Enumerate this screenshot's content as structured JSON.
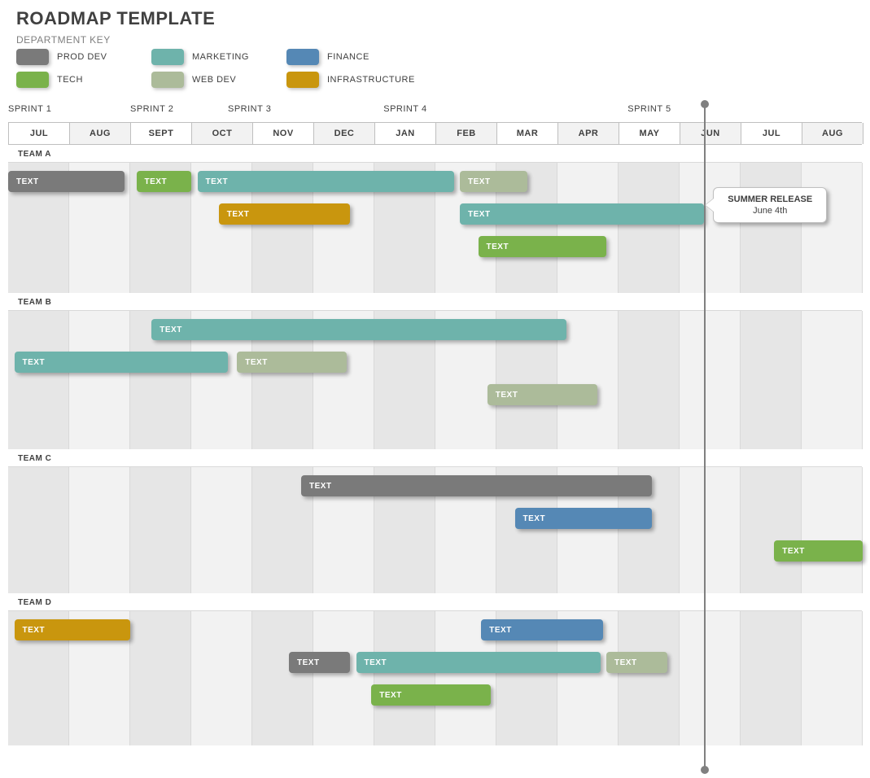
{
  "title": "ROADMAP TEMPLATE",
  "department_key_label": "DEPARTMENT KEY",
  "legend": [
    {
      "name": "PROD DEV",
      "cls": "c-proddev"
    },
    {
      "name": "MARKETING",
      "cls": "c-marketing"
    },
    {
      "name": "FINANCE",
      "cls": "c-finance"
    },
    {
      "name": "TECH",
      "cls": "c-tech"
    },
    {
      "name": "WEB DEV",
      "cls": "c-webdev"
    },
    {
      "name": "INFRASTRUCTURE",
      "cls": "c-infra"
    }
  ],
  "sprints": [
    {
      "label": "SPRINT 1",
      "col": 0
    },
    {
      "label": "SPRINT 2",
      "col": 2
    },
    {
      "label": "SPRINT 3",
      "col": 3.6
    },
    {
      "label": "SPRINT 4",
      "col": 6.15
    },
    {
      "label": "SPRINT 5",
      "col": 10.15
    }
  ],
  "months": [
    "JUL",
    "AUG",
    "SEPT",
    "OCT",
    "NOV",
    "DEC",
    "JAN",
    "FEB",
    "MAR",
    "APR",
    "MAY",
    "JUN",
    "JUL",
    "AUG"
  ],
  "milestone": {
    "title": "SUMMER RELEASE",
    "sub": "June 4th"
  },
  "teams": [
    {
      "name": "TEAM A",
      "height": 160,
      "bars": [
        {
          "label": "TEXT",
          "cls": "c-proddev",
          "start": 0,
          "span": 1.9,
          "row": 0
        },
        {
          "label": "TEXT",
          "cls": "c-tech",
          "start": 2.1,
          "span": 0.9,
          "row": 0
        },
        {
          "label": "TEXT",
          "cls": "c-marketing",
          "start": 3.1,
          "span": 4.2,
          "row": 0
        },
        {
          "label": "TEXT",
          "cls": "c-webdev",
          "start": 7.4,
          "span": 1.1,
          "row": 0
        },
        {
          "label": "TEXT",
          "cls": "c-infra",
          "start": 3.45,
          "span": 2.15,
          "row": 1
        },
        {
          "label": "TEXT",
          "cls": "c-marketing",
          "start": 7.4,
          "span": 4.0,
          "row": 1
        },
        {
          "label": "TEXT",
          "cls": "c-tech",
          "start": 7.7,
          "span": 2.1,
          "row": 2
        }
      ]
    },
    {
      "name": "TEAM B",
      "height": 170,
      "bars": [
        {
          "label": "TEXT",
          "cls": "c-marketing",
          "start": 2.35,
          "span": 6.8,
          "row": 0
        },
        {
          "label": "TEXT",
          "cls": "c-marketing",
          "start": 0.1,
          "span": 3.5,
          "row": 1
        },
        {
          "label": "TEXT",
          "cls": "c-webdev",
          "start": 3.75,
          "span": 1.8,
          "row": 1
        },
        {
          "label": "TEXT",
          "cls": "c-webdev",
          "start": 7.85,
          "span": 1.8,
          "row": 2
        }
      ]
    },
    {
      "name": "TEAM C",
      "height": 155,
      "bars": [
        {
          "label": "TEXT",
          "cls": "c-proddev",
          "start": 4.8,
          "span": 5.75,
          "row": 0
        },
        {
          "label": "TEXT",
          "cls": "c-finance",
          "start": 8.3,
          "span": 2.25,
          "row": 1
        },
        {
          "label": "TEXT",
          "cls": "c-tech",
          "start": 12.55,
          "span": 1.45,
          "row": 2
        }
      ]
    },
    {
      "name": "TEAM D",
      "height": 165,
      "bars": [
        {
          "label": "TEXT",
          "cls": "c-infra",
          "start": 0.1,
          "span": 1.9,
          "row": 0
        },
        {
          "label": "TEXT",
          "cls": "c-finance",
          "start": 7.75,
          "span": 2.0,
          "row": 0
        },
        {
          "label": "TEXT",
          "cls": "c-proddev",
          "start": 4.6,
          "span": 1.0,
          "row": 1
        },
        {
          "label": "TEXT",
          "cls": "c-marketing",
          "start": 5.7,
          "span": 4.0,
          "row": 1
        },
        {
          "label": "TEXT",
          "cls": "c-webdev",
          "start": 9.8,
          "span": 1.0,
          "row": 1
        },
        {
          "label": "TEXT",
          "cls": "c-tech",
          "start": 5.95,
          "span": 1.95,
          "row": 2
        }
      ]
    }
  ],
  "chart_data": {
    "type": "gantt",
    "title": "ROADMAP TEMPLATE",
    "x_axis_months": [
      "JUL",
      "AUG",
      "SEPT",
      "OCT",
      "NOV",
      "DEC",
      "JAN",
      "FEB",
      "MAR",
      "APR",
      "MAY",
      "JUN",
      "JUL",
      "AUG"
    ],
    "sprint_markers": {
      "SPRINT 1": "JUL",
      "SPRINT 2": "SEPT",
      "SPRINT 3": "mid-OCT",
      "SPRINT 4": "JAN",
      "SPRINT 5": "MAY"
    },
    "milestone": {
      "name": "SUMMER RELEASE",
      "date": "June 4th"
    },
    "departments": [
      "PROD DEV",
      "MARKETING",
      "FINANCE",
      "TECH",
      "WEB DEV",
      "INFRASTRUCTURE"
    ],
    "teams": {
      "TEAM A": [
        {
          "dept": "PROD DEV",
          "label": "TEXT",
          "start_month": "JUL",
          "end_month": "AUG"
        },
        {
          "dept": "TECH",
          "label": "TEXT",
          "start_month": "SEPT",
          "end_month": "SEPT"
        },
        {
          "dept": "MARKETING",
          "label": "TEXT",
          "start_month": "OCT",
          "end_month": "JAN"
        },
        {
          "dept": "WEB DEV",
          "label": "TEXT",
          "start_month": "FEB",
          "end_month": "FEB"
        },
        {
          "dept": "INFRASTRUCTURE",
          "label": "TEXT",
          "start_month": "mid-OCT",
          "end_month": "mid-DEC"
        },
        {
          "dept": "MARKETING",
          "label": "TEXT",
          "start_month": "FEB",
          "end_month": "MAY"
        },
        {
          "dept": "TECH",
          "label": "TEXT",
          "start_month": "mid-FEB",
          "end_month": "APR"
        }
      ],
      "TEAM B": [
        {
          "dept": "MARKETING",
          "label": "TEXT",
          "start_month": "SEPT",
          "end_month": "MAR"
        },
        {
          "dept": "MARKETING",
          "label": "TEXT",
          "start_month": "JUL",
          "end_month": "mid-OCT"
        },
        {
          "dept": "WEB DEV",
          "label": "TEXT",
          "start_month": "mid-OCT",
          "end_month": "mid-DEC"
        },
        {
          "dept": "WEB DEV",
          "label": "TEXT",
          "start_month": "mid-FEB",
          "end_month": "APR"
        }
      ],
      "TEAM C": [
        {
          "dept": "PROD DEV",
          "label": "TEXT",
          "start_month": "mid-NOV",
          "end_month": "mid-MAY"
        },
        {
          "dept": "FINANCE",
          "label": "TEXT",
          "start_month": "MAR",
          "end_month": "mid-MAY"
        },
        {
          "dept": "TECH",
          "label": "TEXT",
          "start_month": "mid-JUL(2)",
          "end_month": "AUG(2)"
        }
      ],
      "TEAM D": [
        {
          "dept": "INFRASTRUCTURE",
          "label": "TEXT",
          "start_month": "JUL",
          "end_month": "AUG"
        },
        {
          "dept": "FINANCE",
          "label": "TEXT",
          "start_month": "mid-FEB",
          "end_month": "APR"
        },
        {
          "dept": "PROD DEV",
          "label": "TEXT",
          "start_month": "mid-NOV",
          "end_month": "mid-DEC"
        },
        {
          "dept": "MARKETING",
          "label": "TEXT",
          "start_month": "mid-DEC",
          "end_month": "APR"
        },
        {
          "dept": "WEB DEV",
          "label": "TEXT",
          "start_month": "mid-APR",
          "end_month": "mid-MAY"
        },
        {
          "dept": "TECH",
          "label": "TEXT",
          "start_month": "mid-DEC",
          "end_month": "FEB"
        }
      ]
    }
  }
}
